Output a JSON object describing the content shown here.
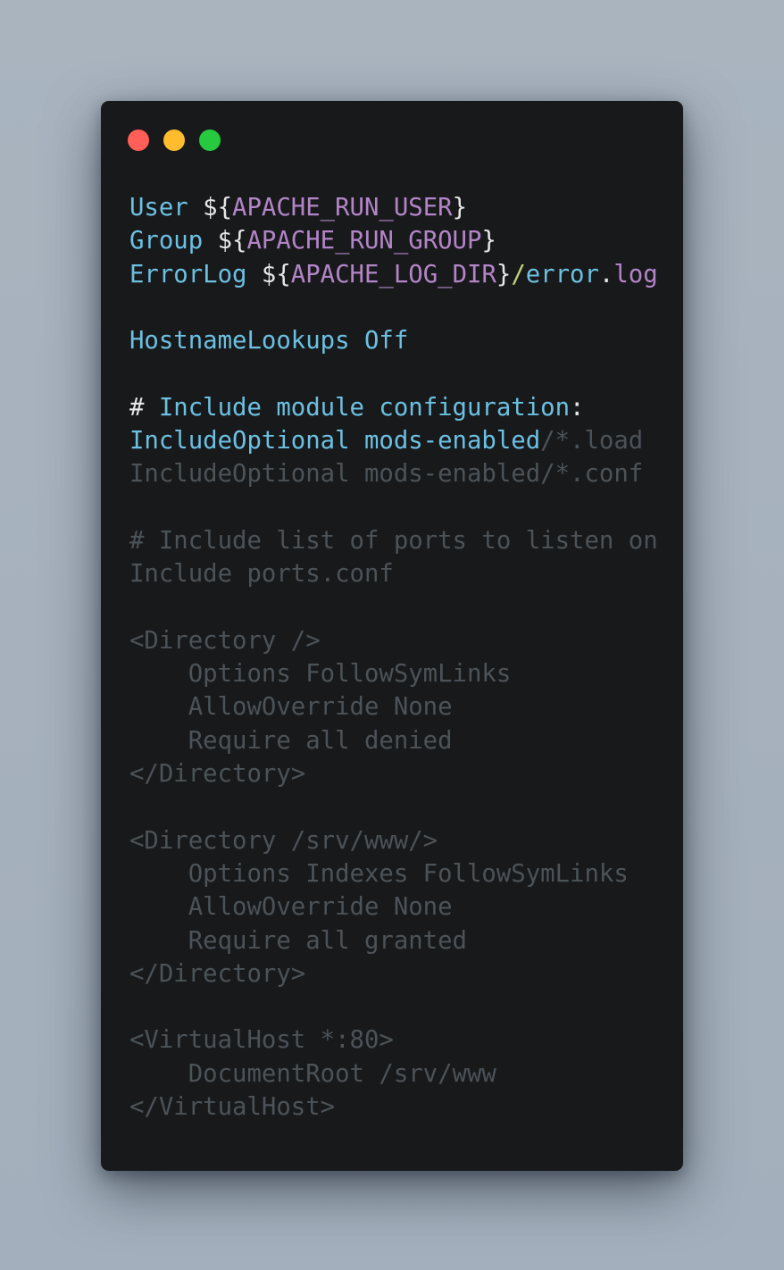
{
  "window": {
    "controls": [
      {
        "name": "close",
        "color": "#ff5f56"
      },
      {
        "name": "minimize",
        "color": "#ffbd2e"
      },
      {
        "name": "maximize",
        "color": "#27c93f"
      }
    ]
  },
  "code": {
    "language": "apache",
    "lines": [
      {
        "tokens": [
          {
            "t": "User ",
            "c": "kw"
          },
          {
            "t": "$",
            "c": "punc"
          },
          {
            "t": "{",
            "c": "punc"
          },
          {
            "t": "APACHE_RUN_USER",
            "c": "var"
          },
          {
            "t": "}",
            "c": "punc"
          }
        ]
      },
      {
        "tokens": [
          {
            "t": "Group ",
            "c": "kw"
          },
          {
            "t": "$",
            "c": "punc"
          },
          {
            "t": "{",
            "c": "punc"
          },
          {
            "t": "APACHE_RUN_GROUP",
            "c": "var"
          },
          {
            "t": "}",
            "c": "punc"
          }
        ]
      },
      {
        "tokens": [
          {
            "t": "ErrorLog ",
            "c": "kw"
          },
          {
            "t": "$",
            "c": "punc"
          },
          {
            "t": "{",
            "c": "punc"
          },
          {
            "t": "APACHE_LOG_DIR",
            "c": "var"
          },
          {
            "t": "}",
            "c": "punc"
          },
          {
            "t": "/",
            "c": "slash"
          },
          {
            "t": "error",
            "c": "kw"
          },
          {
            "t": ".",
            "c": "punc"
          },
          {
            "t": "log",
            "c": "var"
          }
        ]
      },
      {
        "tokens": []
      },
      {
        "tokens": [
          {
            "t": "HostnameLookups Off",
            "c": "kw"
          }
        ]
      },
      {
        "tokens": []
      },
      {
        "tokens": [
          {
            "t": "# ",
            "c": "hash"
          },
          {
            "t": "Include module configuration",
            "c": "kw"
          },
          {
            "t": ":",
            "c": "punc"
          }
        ]
      },
      {
        "tokens": [
          {
            "t": "IncludeOptional mods-enabled",
            "c": "kw"
          },
          {
            "t": "/*.load",
            "c": "dim"
          }
        ]
      },
      {
        "tokens": [
          {
            "t": "IncludeOptional mods-enabled/*.conf",
            "c": "dim"
          }
        ]
      },
      {
        "tokens": []
      },
      {
        "tokens": [
          {
            "t": "# Include list of ports to listen on",
            "c": "dim"
          }
        ]
      },
      {
        "tokens": [
          {
            "t": "Include ports.conf",
            "c": "dim"
          }
        ]
      },
      {
        "tokens": []
      },
      {
        "tokens": [
          {
            "t": "<Directory />",
            "c": "dim"
          }
        ]
      },
      {
        "tokens": [
          {
            "t": "    Options FollowSymLinks",
            "c": "dim"
          }
        ]
      },
      {
        "tokens": [
          {
            "t": "    AllowOverride None",
            "c": "dim"
          }
        ]
      },
      {
        "tokens": [
          {
            "t": "    Require all denied",
            "c": "dim"
          }
        ]
      },
      {
        "tokens": [
          {
            "t": "</Directory>",
            "c": "dim"
          }
        ]
      },
      {
        "tokens": []
      },
      {
        "tokens": [
          {
            "t": "<Directory /srv/www/>",
            "c": "dim"
          }
        ]
      },
      {
        "tokens": [
          {
            "t": "    Options Indexes FollowSymLinks",
            "c": "dim"
          }
        ]
      },
      {
        "tokens": [
          {
            "t": "    AllowOverride None",
            "c": "dim"
          }
        ]
      },
      {
        "tokens": [
          {
            "t": "    Require all granted",
            "c": "dim"
          }
        ]
      },
      {
        "tokens": [
          {
            "t": "</Directory>",
            "c": "dim"
          }
        ]
      },
      {
        "tokens": []
      },
      {
        "tokens": [
          {
            "t": "<VirtualHost *:80>",
            "c": "dim"
          }
        ]
      },
      {
        "tokens": [
          {
            "t": "    DocumentRoot /srv/www",
            "c": "dim"
          }
        ]
      },
      {
        "tokens": [
          {
            "t": "</VirtualHost>",
            "c": "dim"
          }
        ]
      }
    ]
  }
}
